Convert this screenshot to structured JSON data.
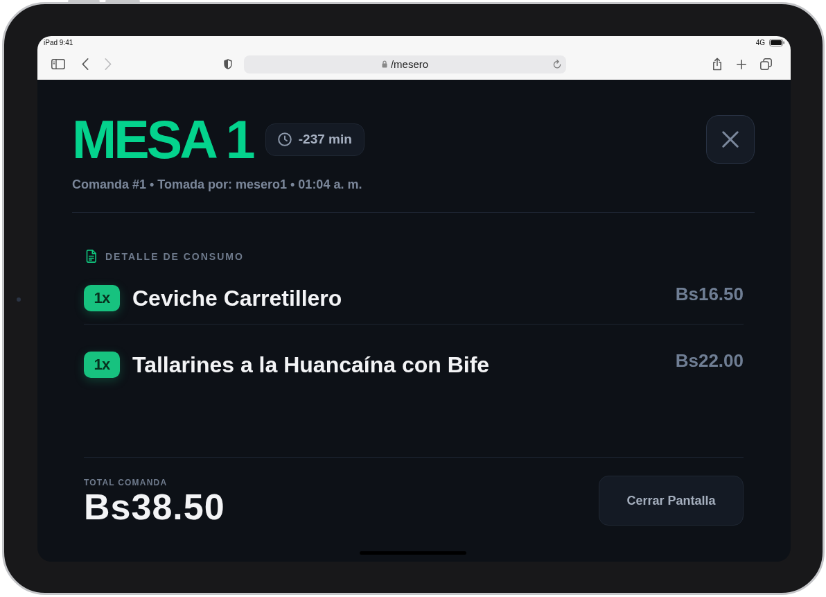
{
  "status_bar": {
    "device_time": "iPad 9:41",
    "network": "4G"
  },
  "browser": {
    "navigation": [
      {
        "kind": "back",
        "disabled": false
      },
      {
        "kind": "forward",
        "disabled": true
      }
    ],
    "url": "/mesero"
  },
  "modal": {
    "title": "MESA 1",
    "timer": "-237 min",
    "subtitle": "Comanda #1 • Tomada por: mesero1 • 01:04 a. m.",
    "section_title": "DETALLE DE CONSUMO",
    "items": [
      {
        "quantity": "1x",
        "name": "Ceviche Carretillero",
        "price": "Bs16.50"
      },
      {
        "quantity": "1x",
        "name": "Tallarines a la Huancaína con Bife",
        "price": "Bs22.00"
      }
    ],
    "total_label": "TOTAL COMANDA",
    "total": "Bs38.50",
    "close_button": "Cerrar Pantalla"
  }
}
